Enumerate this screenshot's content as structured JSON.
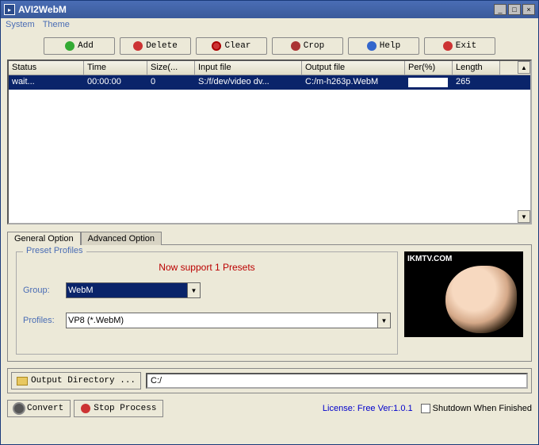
{
  "window": {
    "title": "AVI2WebM"
  },
  "menu": {
    "system": "System",
    "theme": "Theme"
  },
  "toolbar": {
    "add": "Add",
    "delete": "Delete",
    "clear": "Clear",
    "crop": "Crop",
    "help": "Help",
    "exit": "Exit"
  },
  "table": {
    "headers": {
      "status": "Status",
      "time": "Time",
      "size": "Size(...",
      "input": "Input file",
      "output": "Output file",
      "per": "Per(%)",
      "length": "Length"
    },
    "rows": [
      {
        "status": "wait...",
        "time": "00:00:00",
        "size": "0",
        "input": "S:/f/dev/video dv...",
        "output": "C:/m-h263p.WebM",
        "per": "",
        "length": "265"
      }
    ]
  },
  "tabs": {
    "general": "General Option",
    "advanced": "Advanced Option"
  },
  "preset": {
    "legend": "Preset Profiles",
    "message": "Now support 1 Presets",
    "group_label": "Group:",
    "group_value": "WebM",
    "profiles_label": "Profiles:",
    "profiles_value": "VP8 (*.WebM)"
  },
  "preview": {
    "tag": "IKMTV.COM"
  },
  "output": {
    "button": "Output Directory ...",
    "path": "C:/"
  },
  "footer": {
    "convert": "Convert",
    "stop": "Stop Process",
    "license": "License: Free Ver:1.0.1",
    "shutdown": "Shutdown When Finished"
  }
}
